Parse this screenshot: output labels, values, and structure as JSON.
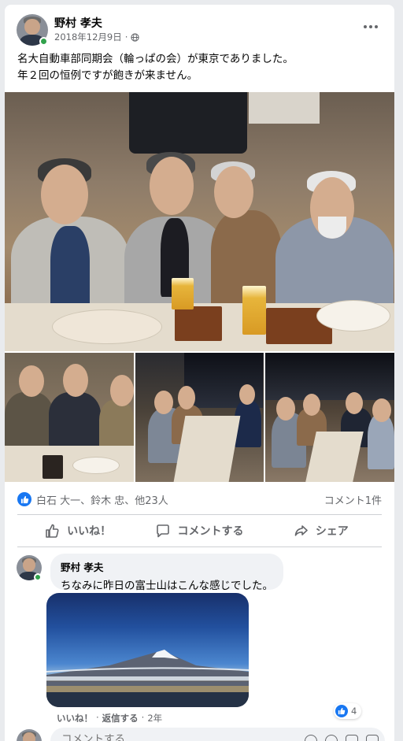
{
  "post": {
    "author": "野村 孝夫",
    "date": "2018年12月9日",
    "meta_separator": "·",
    "privacy_icon": "globe-icon",
    "more_icon": "more-icon",
    "text_line1": "名大自動車部同期会（輪っぱの会）が東京でありました。",
    "text_line2": "年２回の恒例ですが飽きが来ません。"
  },
  "photos": {
    "count": 4,
    "layout": "one large on top, three squares below"
  },
  "reactions": {
    "icon": "like-icon",
    "text": "白石 大一、鈴木 忠、他23人",
    "comment_count": "コメント1件"
  },
  "actions": {
    "like": "いいね！",
    "comment": "コメントする",
    "share": "シェア"
  },
  "comment": {
    "author": "野村 孝夫",
    "text": "ちなみに昨日の富士山はこんな感じでした。",
    "like_link": "いいね！",
    "reply_link": "返信する",
    "separator": "·",
    "age": "2年",
    "reaction_count": "4"
  },
  "write_comment": {
    "placeholder": "コメントする"
  },
  "colors": {
    "accent": "#1877f2",
    "online": "#31a24c",
    "muted": "#65676b",
    "bubble": "#f0f2f5"
  }
}
